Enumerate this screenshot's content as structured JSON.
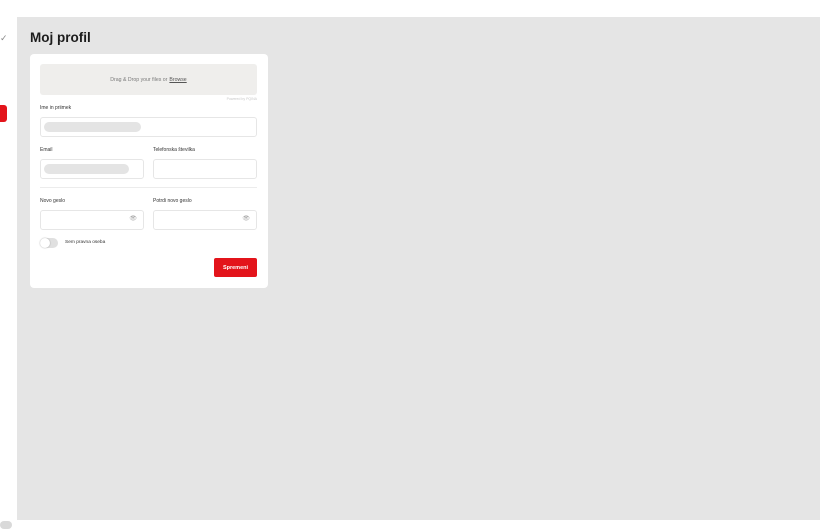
{
  "page": {
    "title": "Moj profil"
  },
  "sidebar": {
    "chevron_icon": "chevron-down-icon"
  },
  "upload": {
    "text": "Drag & Drop your files or",
    "browse_label": "Browse",
    "powered_by": "Powered by PQINA"
  },
  "form": {
    "full_name_label": "Ime in priimek",
    "email_label": "Email",
    "phone_label": "Telefonska številka",
    "new_password_label": "Novo geslo",
    "confirm_password_label": "Potrdi novo geslo",
    "eye_icon": "eye-icon",
    "legal_entity_label": "Sem pravna oseba",
    "legal_entity_checked": false,
    "save_label": "Spremeni"
  },
  "colors": {
    "accent": "#e3141b",
    "background": "#e5e5e5",
    "card": "#ffffff"
  }
}
